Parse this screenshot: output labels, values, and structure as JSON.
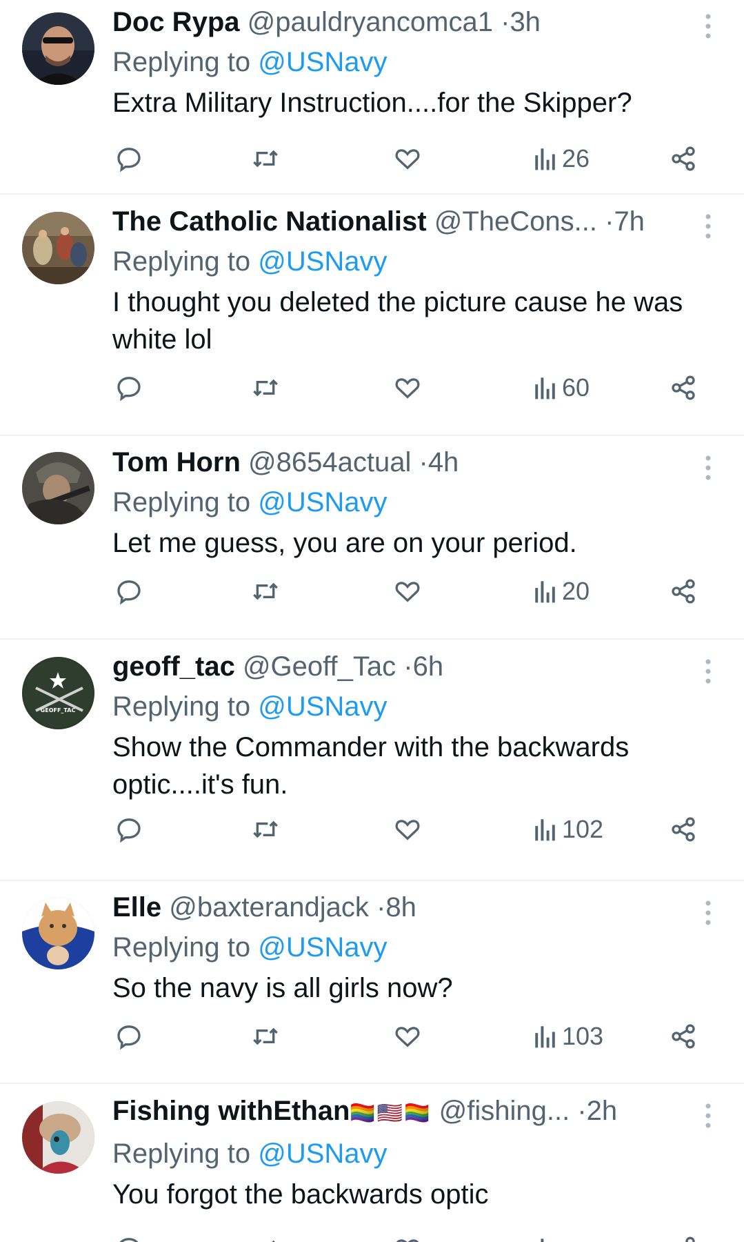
{
  "replying_label": "Replying to",
  "replies": [
    {
      "display_name": "Doc Rypa",
      "handle": "@pauldryancomca1",
      "time": "3h",
      "replying_to": "@USNavy",
      "text": "Extra Military Instruction....for the Skipper?",
      "views": "26",
      "avatar_desc": "man-sunglasses"
    },
    {
      "display_name": "The Catholic Nationalist",
      "handle": "@TheCons...",
      "time": "7h",
      "replying_to": "@USNavy",
      "text": "I thought you deleted the picture cause he was white lol",
      "views": "60",
      "avatar_desc": "painting"
    },
    {
      "display_name": "Tom Horn",
      "handle": "@8654actual",
      "time": "4h",
      "replying_to": "@USNavy",
      "text": "Let me guess, you are on your period.",
      "views": "20",
      "avatar_desc": "soldier"
    },
    {
      "display_name": "geoff_tac",
      "handle": "@Geoff_Tac",
      "time": "6h",
      "replying_to": "@USNavy",
      "text": "Show the Commander with the backwards optic....it's fun.",
      "views": "102",
      "avatar_desc": "rifles-logo"
    },
    {
      "display_name": "Elle",
      "handle": "@baxterandjack",
      "time": "8h",
      "replying_to": "@USNavy",
      "text": "So the navy is all girls now?",
      "views": "103",
      "avatar_desc": "cat"
    },
    {
      "display_name": "Fishing withEthan",
      "flags": "🏳️‍🌈🇺🇸🏳️‍🌈",
      "handle": "@fishing...",
      "time": "2h",
      "replying_to": "@USNavy",
      "text": "You forgot the backwards optic",
      "views": "",
      "avatar_desc": "fish"
    }
  ],
  "colors": {
    "text": "#0f1419",
    "secondary": "#536471",
    "link": "#1d9bf0",
    "divider": "#eff3f4"
  }
}
